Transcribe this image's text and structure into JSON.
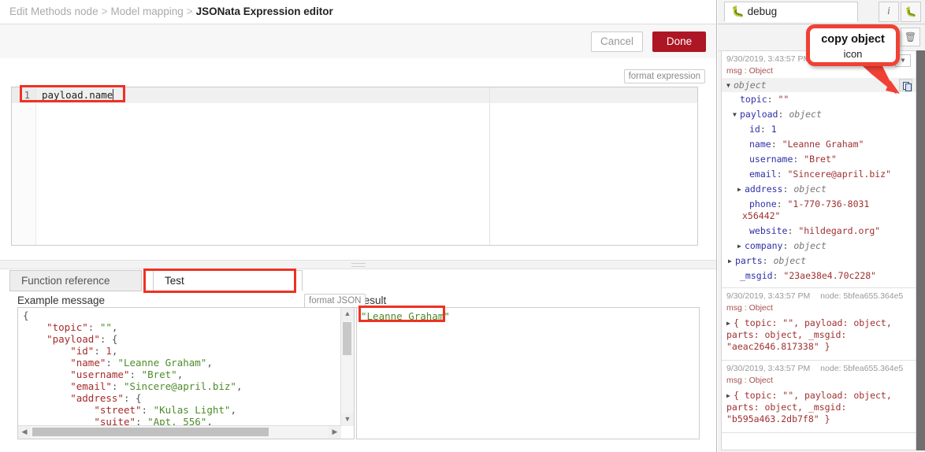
{
  "breadcrumb": {
    "items": [
      "Edit Methods node",
      "Model mapping",
      "JSONata Expression editor"
    ],
    "separator": ">"
  },
  "actionbar": {
    "cancel_label": "Cancel",
    "done_label": "Done",
    "done_color": "#ad1625"
  },
  "expression_editor": {
    "format_button": "format expression",
    "line_number": "1",
    "code": "payload.name"
  },
  "tabs": [
    {
      "label": "Function reference",
      "selected": false
    },
    {
      "label": "Test",
      "selected": true
    }
  ],
  "lower": {
    "example_label": "Example message",
    "format_json_button": "format JSON",
    "result_label": "Result",
    "result_value": "\"Leanne Graham\"",
    "example_json_lines": [
      "{",
      "    \"topic\": \"\",",
      "    \"payload\": {",
      "        \"id\": 1,",
      "        \"name\": \"Leanne Graham\",",
      "        \"username\": \"Bret\",",
      "        \"email\": \"Sincere@april.biz\",",
      "        \"address\": {",
      "            \"street\": \"Kulas Light\",",
      "            \"suite\": \"Apt. 556\","
    ]
  },
  "sidebar": {
    "tab_label": "debug",
    "tab_icon": "bug-icon",
    "info_icon": "info-icon",
    "bug_icon": "bug-icon",
    "trash_icon": "trash-icon",
    "filter_icon": "chevron-down-icon",
    "copy_icon": "copy-object-icon",
    "messages": [
      {
        "timestamp": "9/30/2019, 3:43:57 PM",
        "node": "",
        "type": "msg : Object",
        "expanded": true,
        "root": "object",
        "rows": [
          {
            "indent": 1,
            "arrow": "",
            "name": "topic",
            "value": "\"\"",
            "kind": "string"
          },
          {
            "indent": 1,
            "arrow": "down",
            "name": "payload",
            "value": "object",
            "kind": "type"
          },
          {
            "indent": 2,
            "arrow": "",
            "name": "id",
            "value": "1",
            "kind": "number"
          },
          {
            "indent": 2,
            "arrow": "",
            "name": "name",
            "value": "\"Leanne Graham\"",
            "kind": "string"
          },
          {
            "indent": 2,
            "arrow": "",
            "name": "username",
            "value": "\"Bret\"",
            "kind": "string"
          },
          {
            "indent": 2,
            "arrow": "",
            "name": "email",
            "value": "\"Sincere@april.biz\"",
            "kind": "string"
          },
          {
            "indent": 2,
            "arrow": "right",
            "name": "address",
            "value": "object",
            "kind": "type"
          },
          {
            "indent": 2,
            "arrow": "",
            "name": "phone",
            "value": "\"1-770-736-8031 x56442\"",
            "kind": "string"
          },
          {
            "indent": 2,
            "arrow": "",
            "name": "website",
            "value": "\"hildegard.org\"",
            "kind": "string"
          },
          {
            "indent": 2,
            "arrow": "right",
            "name": "company",
            "value": "object",
            "kind": "type"
          },
          {
            "indent": 1,
            "arrow": "right",
            "name": "parts",
            "value": "object",
            "kind": "type"
          },
          {
            "indent": 1,
            "arrow": "",
            "name": "_msgid",
            "value": "\"23ae38e4.70c228\"",
            "kind": "string"
          }
        ]
      },
      {
        "timestamp": "9/30/2019, 3:43:57 PM",
        "node": "node: 5bfea655.364e5",
        "type": "msg : Object",
        "expanded": false,
        "inline": "{ topic: \"\", payload: object, parts: object, _msgid: \"aeac2646.817338\" }"
      },
      {
        "timestamp": "9/30/2019, 3:43:57 PM",
        "node": "node: 5bfea655.364e5",
        "type": "msg : Object",
        "expanded": false,
        "inline": "{ topic: \"\", payload: object, parts: object, _msgid: \"b595a463.2db7f8\" }"
      }
    ]
  },
  "annotations": {
    "callout_line1": "copy object",
    "callout_line2": "icon",
    "highlight_color": "#ee3124"
  }
}
